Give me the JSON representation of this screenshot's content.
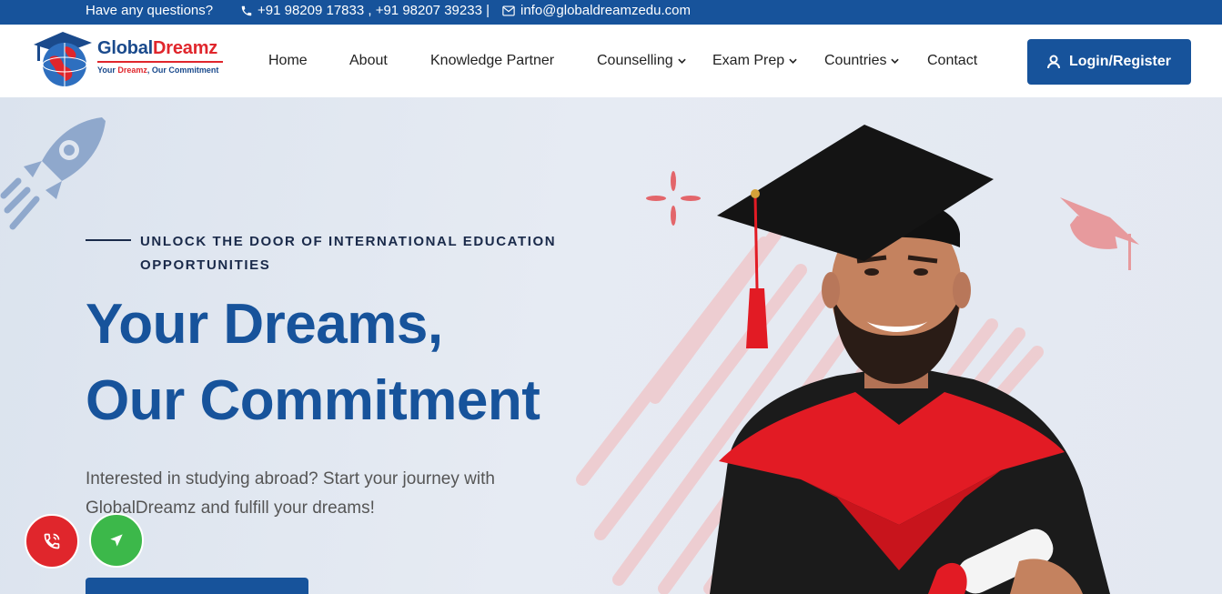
{
  "topbar": {
    "question": "Have any questions?",
    "phones": "+91 98209 17833  ,  +91 98207 39233 |",
    "email": "info@globaldreamzedu.com"
  },
  "logo": {
    "brand_a": "Global",
    "brand_b": "Dreamz",
    "tag_a": "Your ",
    "tag_b": "Dreamz",
    "tag_c": ", Our Commitment"
  },
  "nav": {
    "home": "Home",
    "about": "About",
    "knowledge": "Knowledge Partner",
    "counselling": "Counselling",
    "exam": "Exam Prep",
    "countries": "Countries",
    "contact": "Contact"
  },
  "login": {
    "label": "Login/Register"
  },
  "hero": {
    "eyebrow": "UNLOCK THE DOOR OF INTERNATIONAL EDUCATION OPPORTUNITIES",
    "headline_1": "Your Dreams,",
    "headline_2": "Our Commitment",
    "sub": "Interested in studying abroad? Start your journey with GlobalDreamz and fulfill your dreams!"
  },
  "colors": {
    "primary": "#17539b",
    "accent_red": "#e0262c",
    "accent_green": "#3cb84a"
  }
}
